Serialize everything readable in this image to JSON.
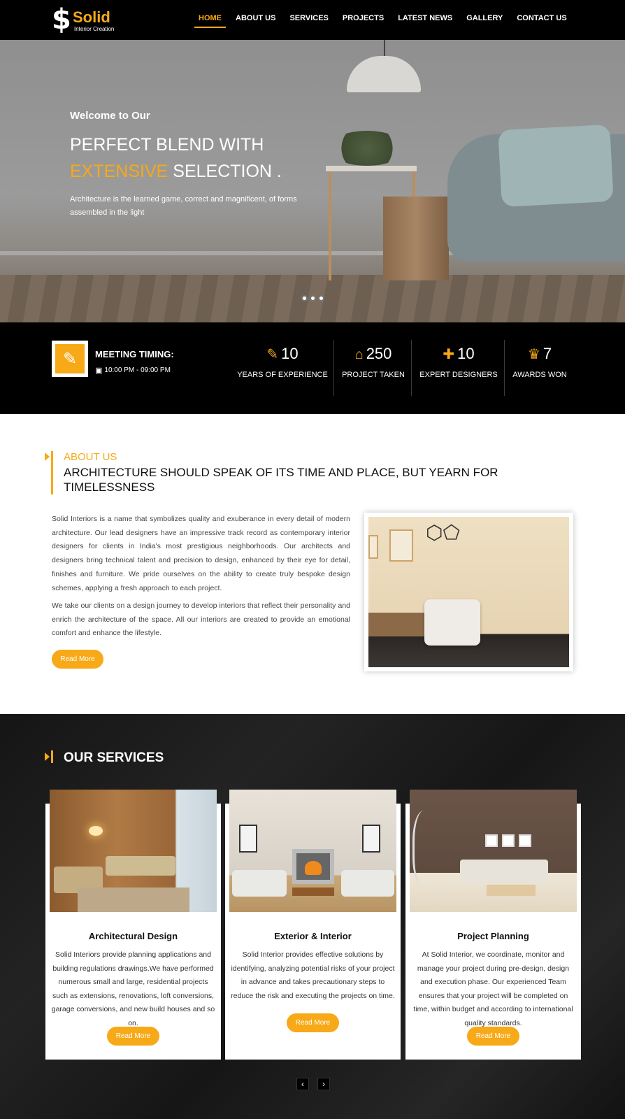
{
  "brand": {
    "logo_symbol": "$",
    "name": "Solid",
    "tagline": "Interior Creation"
  },
  "nav": {
    "items": [
      {
        "label": "HOME"
      },
      {
        "label": "ABOUT US"
      },
      {
        "label": "SERVICES"
      },
      {
        "label": "PROJECTS"
      },
      {
        "label": "LATEST NEWS"
      },
      {
        "label": "GALLERY"
      },
      {
        "label": "CONTACT US"
      }
    ],
    "active": "HOME"
  },
  "hero": {
    "welcome": "Welcome to Our",
    "line1": "PERFECT BLEND WITH",
    "highlight": "EXTENSIVE",
    "line2_rest": " SELECTION .",
    "subtitle": "Architecture is the learned game, correct and magnificent, of forms assembled in the light",
    "slide_count": 3
  },
  "meeting": {
    "icon": "pencil-icon",
    "title": "MEETING TIMING:",
    "calendar_icon": "calendar-icon",
    "time": "10:00 PM - 09:00 PM"
  },
  "stats": [
    {
      "icon": "edit-icon",
      "glyph": "✎",
      "value": "10",
      "label": "YEARS OF EXPERIENCE"
    },
    {
      "icon": "home-icon",
      "glyph": "⌂",
      "value": "250",
      "label": "PROJECT TAKEN"
    },
    {
      "icon": "plus-icon",
      "glyph": "✚",
      "value": "10",
      "label": "EXPERT DESIGNERS"
    },
    {
      "icon": "trophy-icon",
      "glyph": "♛",
      "value": "7",
      "label": "AWARDS WON"
    }
  ],
  "about": {
    "kicker": "ABOUT US",
    "title": "ARCHITECTURE SHOULD SPEAK OF ITS TIME AND PLACE, BUT YEARN FOR TIMELESSNESS",
    "p1": "Solid Interiors is a name that symbolizes quality and exuberance in every detail of modern architecture. Our lead designers have an impressive track record as contemporary interior designers for clients in India's most prestigious neighborhoods. Our architects and designers bring technical talent and precision to design, enhanced by their eye for detail, finishes and furniture. We pride ourselves on the ability to create truly bespoke design schemes, applying a fresh approach to each project.",
    "p2": "We take our clients on a design journey to develop interiors that reflect their personality and enrich the architecture of the space. All our interiors are created to provide an emotional comfort and enhance the lifestyle.",
    "button": "Read More"
  },
  "services": {
    "title": "OUR SERVICES",
    "cards": [
      {
        "title": "Architectural Design",
        "desc": "Solid Interiors provide planning applications and building regulations drawings.We have performed numerous small and large, residential projects such as extensions, renovations, loft conversions, garage conversions, and new build houses and so on.",
        "button": "Read More"
      },
      {
        "title": "Exterior & Interior",
        "desc": "Solid Interior provides effective solutions by identifying, analyzing potential risks of your project in advance and takes precautionary steps to reduce the risk and executing the projects on time.",
        "button": "Read More"
      },
      {
        "title": "Project Planning",
        "desc": "At Solid Interior, we coordinate, monitor and manage your project during pre-design, design and execution phase. Our experienced Team ensures that your project will be completed on time, within budget and according to international quality standards.",
        "button": "Read More"
      }
    ],
    "prev": "‹",
    "next": "›"
  },
  "colors": {
    "accent": "#f7a917",
    "dark": "#000000",
    "text": "#444444"
  }
}
